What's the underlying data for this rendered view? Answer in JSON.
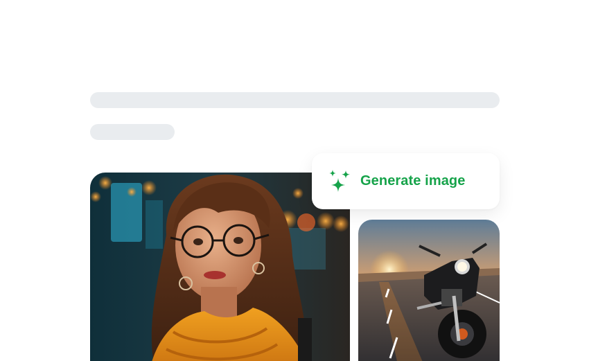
{
  "generate": {
    "label": "Generate image",
    "icon": "sparkles-icon",
    "color": "#16a34a"
  },
  "images": [
    {
      "name": "portrait-image"
    },
    {
      "name": "motorcycle-image"
    }
  ]
}
